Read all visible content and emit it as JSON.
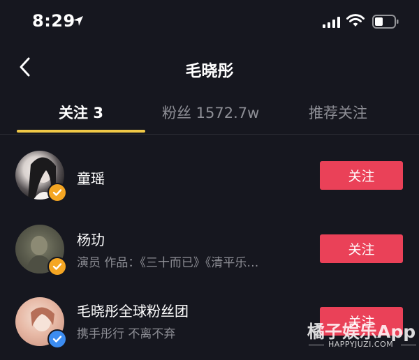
{
  "status_bar": {
    "time": "8:29",
    "icons": [
      "location-arrow-icon",
      "signal-icon",
      "wifi-icon",
      "battery-icon"
    ]
  },
  "nav": {
    "title": "毛晓彤",
    "back_icon": "chevron-left-icon"
  },
  "tabs": [
    {
      "label": "关注 3",
      "active": true
    },
    {
      "label": "粉丝 1572.7w",
      "active": false
    },
    {
      "label": "推荐关注",
      "active": false
    }
  ],
  "list": [
    {
      "name": "童瑶",
      "description": "",
      "verified": "gold",
      "button": "关注"
    },
    {
      "name": "杨玏",
      "description": "演员 作品：《三十而已》《清平乐…",
      "verified": "gold",
      "button": "关注"
    },
    {
      "name": "毛晓彤全球粉丝团",
      "description": "携手彤行 不离不弃",
      "verified": "blue",
      "button": "关注"
    }
  ],
  "watermark": {
    "logo": "橘子娱乐App",
    "url": "HAPPYJUZI.COM"
  },
  "colors": {
    "background": "#16171f",
    "accent_tab": "#f0c846",
    "follow_button": "#ea4158",
    "verified_gold": "#f5a623",
    "verified_blue": "#3c8cf0"
  }
}
